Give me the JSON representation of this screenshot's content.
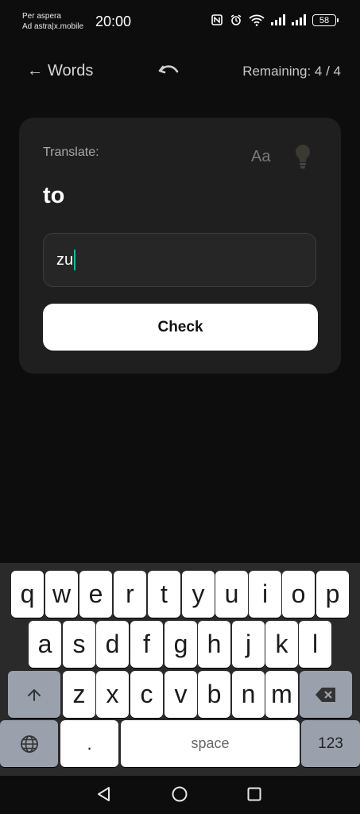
{
  "status_bar": {
    "carrier_line1": "Per aspera",
    "carrier_line2": "Ad astra|x.mobile",
    "time": "20:00",
    "battery": "58",
    "icons": [
      "nfc-icon",
      "alarm-icon",
      "wifi-icon",
      "signal-icon",
      "signal-icon",
      "battery-icon"
    ]
  },
  "header": {
    "back_label": "Words",
    "back_arrow": "←",
    "remaining": "Remaining: 4 / 4"
  },
  "card": {
    "prompt_label": "Translate:",
    "font_toggle": "Aa",
    "word": "to",
    "answer_value": "zu",
    "check_label": "Check",
    "caret_color": "#14b8a6"
  },
  "keyboard": {
    "row1": [
      "q",
      "w",
      "e",
      "r",
      "t",
      "y",
      "u",
      "i",
      "o",
      "p"
    ],
    "row2": [
      "a",
      "s",
      "d",
      "f",
      "g",
      "h",
      "j",
      "k",
      "l"
    ],
    "row3": [
      "z",
      "x",
      "c",
      "v",
      "b",
      "n",
      "m"
    ],
    "period": ".",
    "space": "space",
    "numbers": "123"
  },
  "nav_bar": {
    "icons": [
      "back-triangle-icon",
      "home-circle-icon",
      "recents-square-icon"
    ]
  }
}
